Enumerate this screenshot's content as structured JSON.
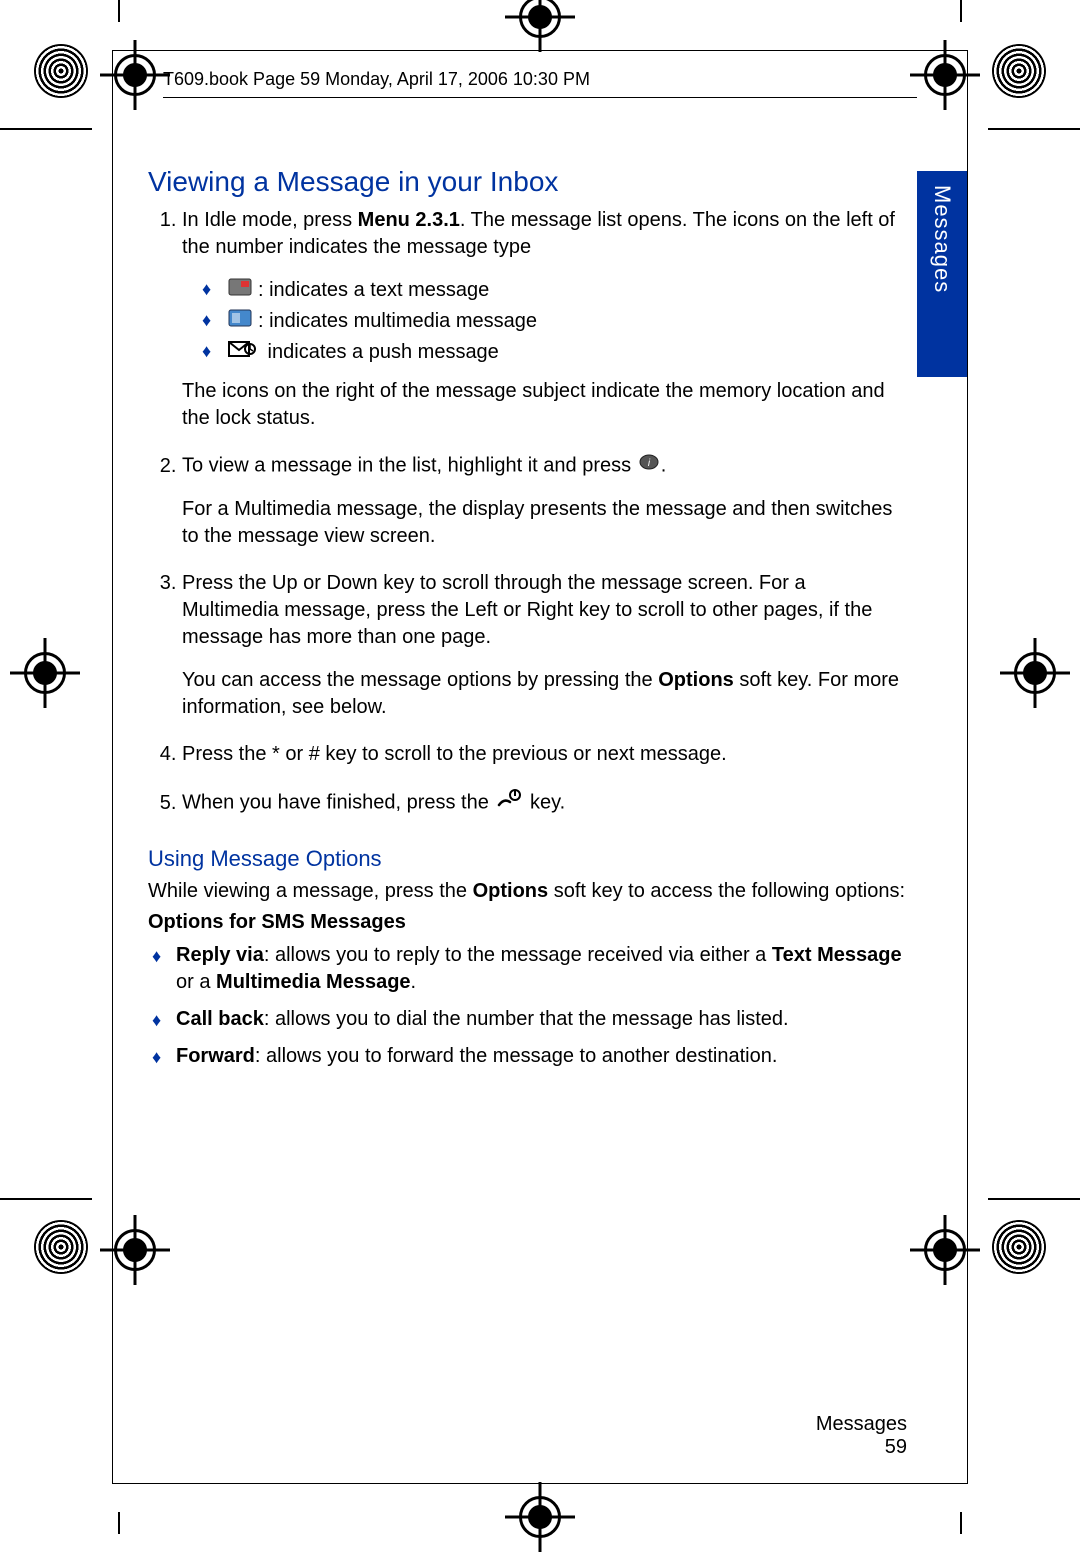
{
  "header": {
    "running_head": "T609.book  Page 59  Monday, April 17, 2006  10:30 PM"
  },
  "side_tab": "Messages",
  "section_title": "Viewing a Message in your Inbox",
  "steps": {
    "s1_pre": "In Idle mode, press ",
    "s1_menu_bold": "Menu 2.3.1",
    "s1_post": ". The message list opens. The icons on the left of the number indicates the message type",
    "icon_text": ": indicates a text message",
    "icon_mms": ": indicates multimedia message",
    "icon_push": " indicates a push message",
    "s1_tail": "The icons on the right of the message subject indicate the memory location and the lock status.",
    "s2_a": "To view a message in the list, highlight it and press ",
    "s2_a_tail": ".",
    "s2_b": "For a Multimedia message, the display presents the message and then switches to the message view screen.",
    "s3_a": "Press the Up or Down key to scroll through the message screen. For a Multimedia message, press the Left or Right key to scroll to other pages, if the message has more than one page.",
    "s3_b_pre": "You can access the message options by pressing the ",
    "s3_b_bold": "Options",
    "s3_b_post": " soft key. For more information, see below.",
    "s4": "Press the *  or # key to scroll to the previous or next message.",
    "s5_pre": "When you have finished, press the ",
    "s5_post": " key."
  },
  "subsection_title": "Using Message Options",
  "options_intro_pre": "While viewing a message, press the ",
  "options_intro_bold": "Options",
  "options_intro_post": " soft key to access the following options:",
  "sms_heading": "Options for SMS Messages",
  "sms": {
    "reply_label": "Reply via",
    "reply_text_a": ": allows you to reply to the message received via either a ",
    "reply_bold1": "Text Message",
    "reply_mid": " or a ",
    "reply_bold2": "Multimedia Message",
    "reply_tail": ".",
    "callback_label": "Call back",
    "callback_text": ": allows you to dial the number that the message has listed.",
    "forward_label": "Forward",
    "forward_text": ": allows you to forward the message to another destination."
  },
  "footer": {
    "chapter": "Messages",
    "page": "59"
  }
}
